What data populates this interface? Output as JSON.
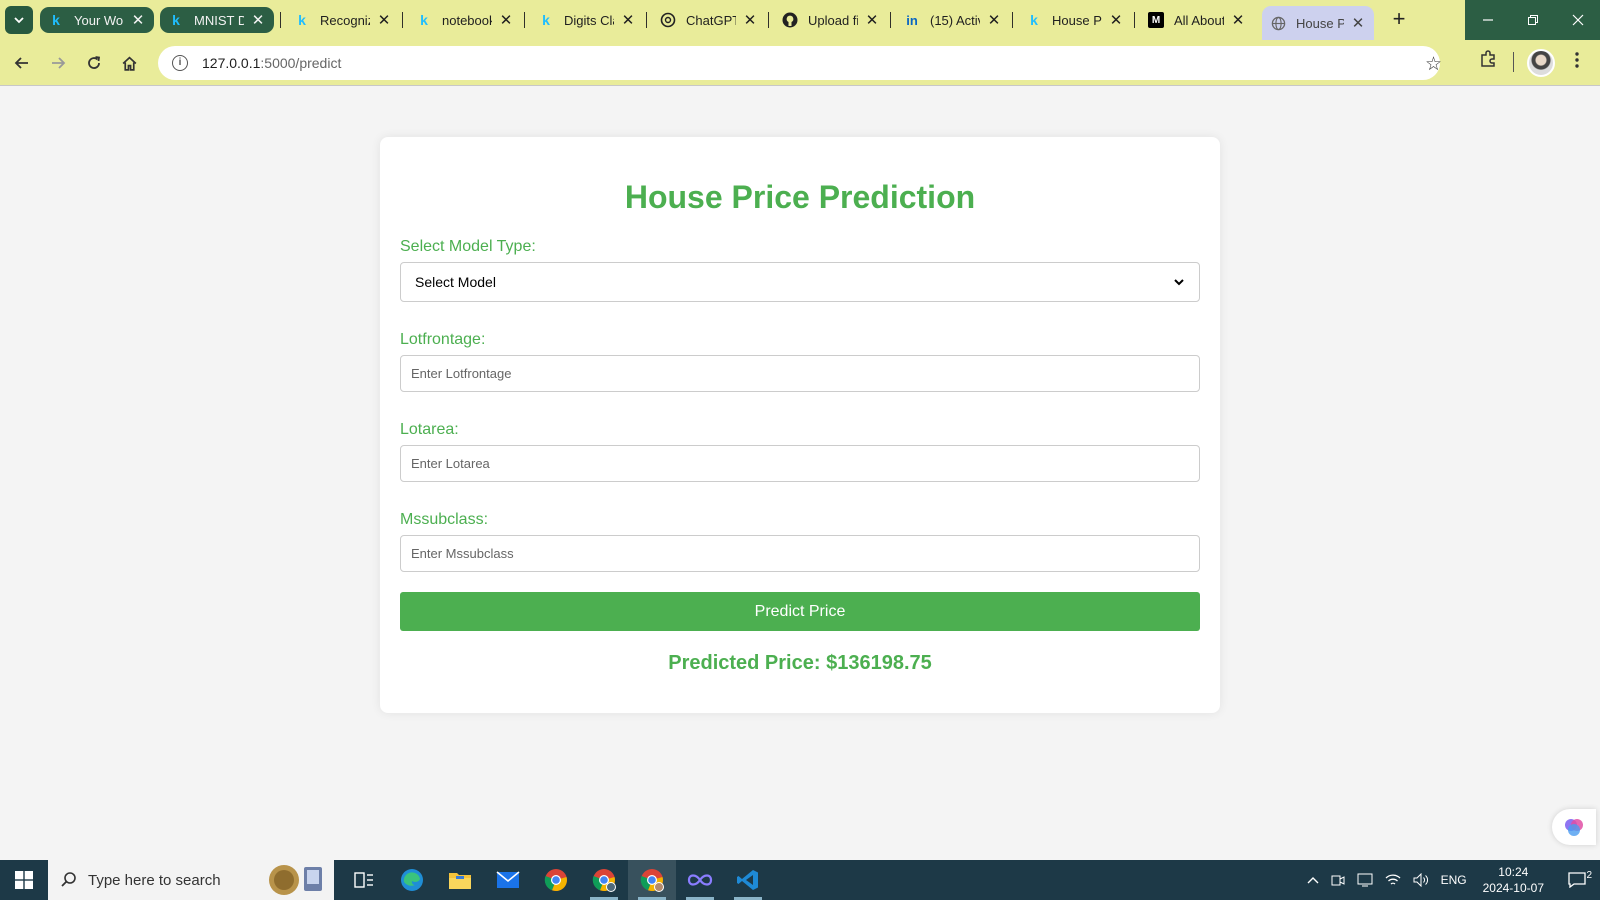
{
  "browser": {
    "tabs": [
      {
        "title": "Your Work",
        "favicon": "kaggle-k",
        "style": "pill"
      },
      {
        "title": "MNIST Da",
        "favicon": "kaggle-k",
        "style": "pill"
      },
      {
        "title": "Recogniz",
        "favicon": "kaggle-k",
        "style": "plain"
      },
      {
        "title": "notebook",
        "favicon": "kaggle-k",
        "style": "plain"
      },
      {
        "title": "Digits Cla",
        "favicon": "kaggle-k",
        "style": "plain"
      },
      {
        "title": "ChatGPT",
        "favicon": "chatgpt",
        "style": "plain"
      },
      {
        "title": "Upload fil",
        "favicon": "github",
        "style": "plain"
      },
      {
        "title": "(15) Activ",
        "favicon": "linkedin",
        "style": "plain"
      },
      {
        "title": "House Pr",
        "favicon": "kaggle-k",
        "style": "plain"
      },
      {
        "title": "All About",
        "favicon": "medium",
        "style": "plain"
      },
      {
        "title": "House Pr",
        "favicon": "globe",
        "style": "active"
      }
    ],
    "url_host": "127.0.0.1",
    "url_rest": ":5000/predict"
  },
  "page": {
    "title": "House Price Prediction",
    "model_label": "Select Model Type:",
    "model_selected": "Select Model",
    "lotfrontage_label": "Lotfrontage:",
    "lotfrontage_placeholder": "Enter Lotfrontage",
    "lotarea_label": "Lotarea:",
    "lotarea_placeholder": "Enter Lotarea",
    "mssubclass_label": "Mssubclass:",
    "mssubclass_placeholder": "Enter Mssubclass",
    "predict_button": "Predict Price",
    "result": "Predicted Price: $136198.75"
  },
  "taskbar": {
    "search_placeholder": "Type here to search",
    "language": "ENG",
    "time": "10:24",
    "date": "2024-10-07",
    "notifications": "2"
  },
  "colors": {
    "accent": "#4caf50",
    "chrome_frame": "#e9ec9a",
    "taskbar": "#1d3947"
  }
}
